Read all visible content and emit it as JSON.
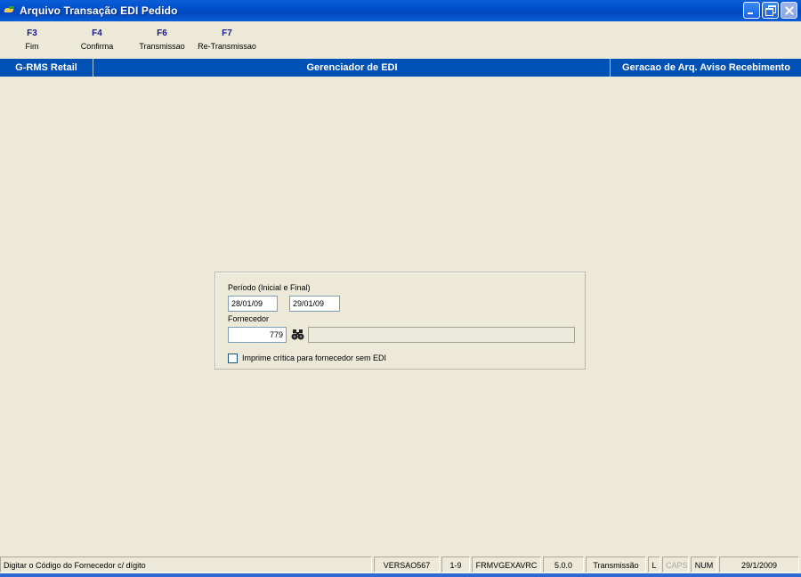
{
  "window": {
    "title": "Arquivo Transação EDI Pedido"
  },
  "toolbar": {
    "items": [
      {
        "key": "F3",
        "label": "Fim"
      },
      {
        "key": "F4",
        "label": "Confirma"
      },
      {
        "key": "F6",
        "label": "Transmissao"
      },
      {
        "key": "F7",
        "label": "Re-Transmissao"
      }
    ]
  },
  "header": {
    "left": "G-RMS Retail",
    "center": "Gerenciador de EDI",
    "right": "Geracao de Arq. Aviso Recebimento"
  },
  "form": {
    "periodo_label": "Período (Inicial e Final)",
    "data_inicial": "28/01/09",
    "data_final": "29/01/09",
    "fornecedor_label": "Fornecedor",
    "fornecedor_codigo": "779",
    "fornecedor_nome": "",
    "checkbox_label": "Imprime crítica para fornecedor sem EDI",
    "checkbox_checked": false
  },
  "statusbar": {
    "message": "Digitar o Código do Fornecedor c/ dígito",
    "versao": "VERSAO567",
    "page": "1-9",
    "form_name": "FRMVGEXAVRC",
    "app_version": "5.0.0",
    "mode": "Transmissão",
    "l_flag": "L",
    "caps": "CAPS",
    "num": "NUM",
    "date": "29/1/2009"
  },
  "colors": {
    "titlebar": "#0a5fd8",
    "header_band": "#0051b3",
    "window_bg": "#ece9d8",
    "toolbar_key": "#1a1a8c"
  },
  "icons": {
    "find": "binoculars-icon"
  }
}
